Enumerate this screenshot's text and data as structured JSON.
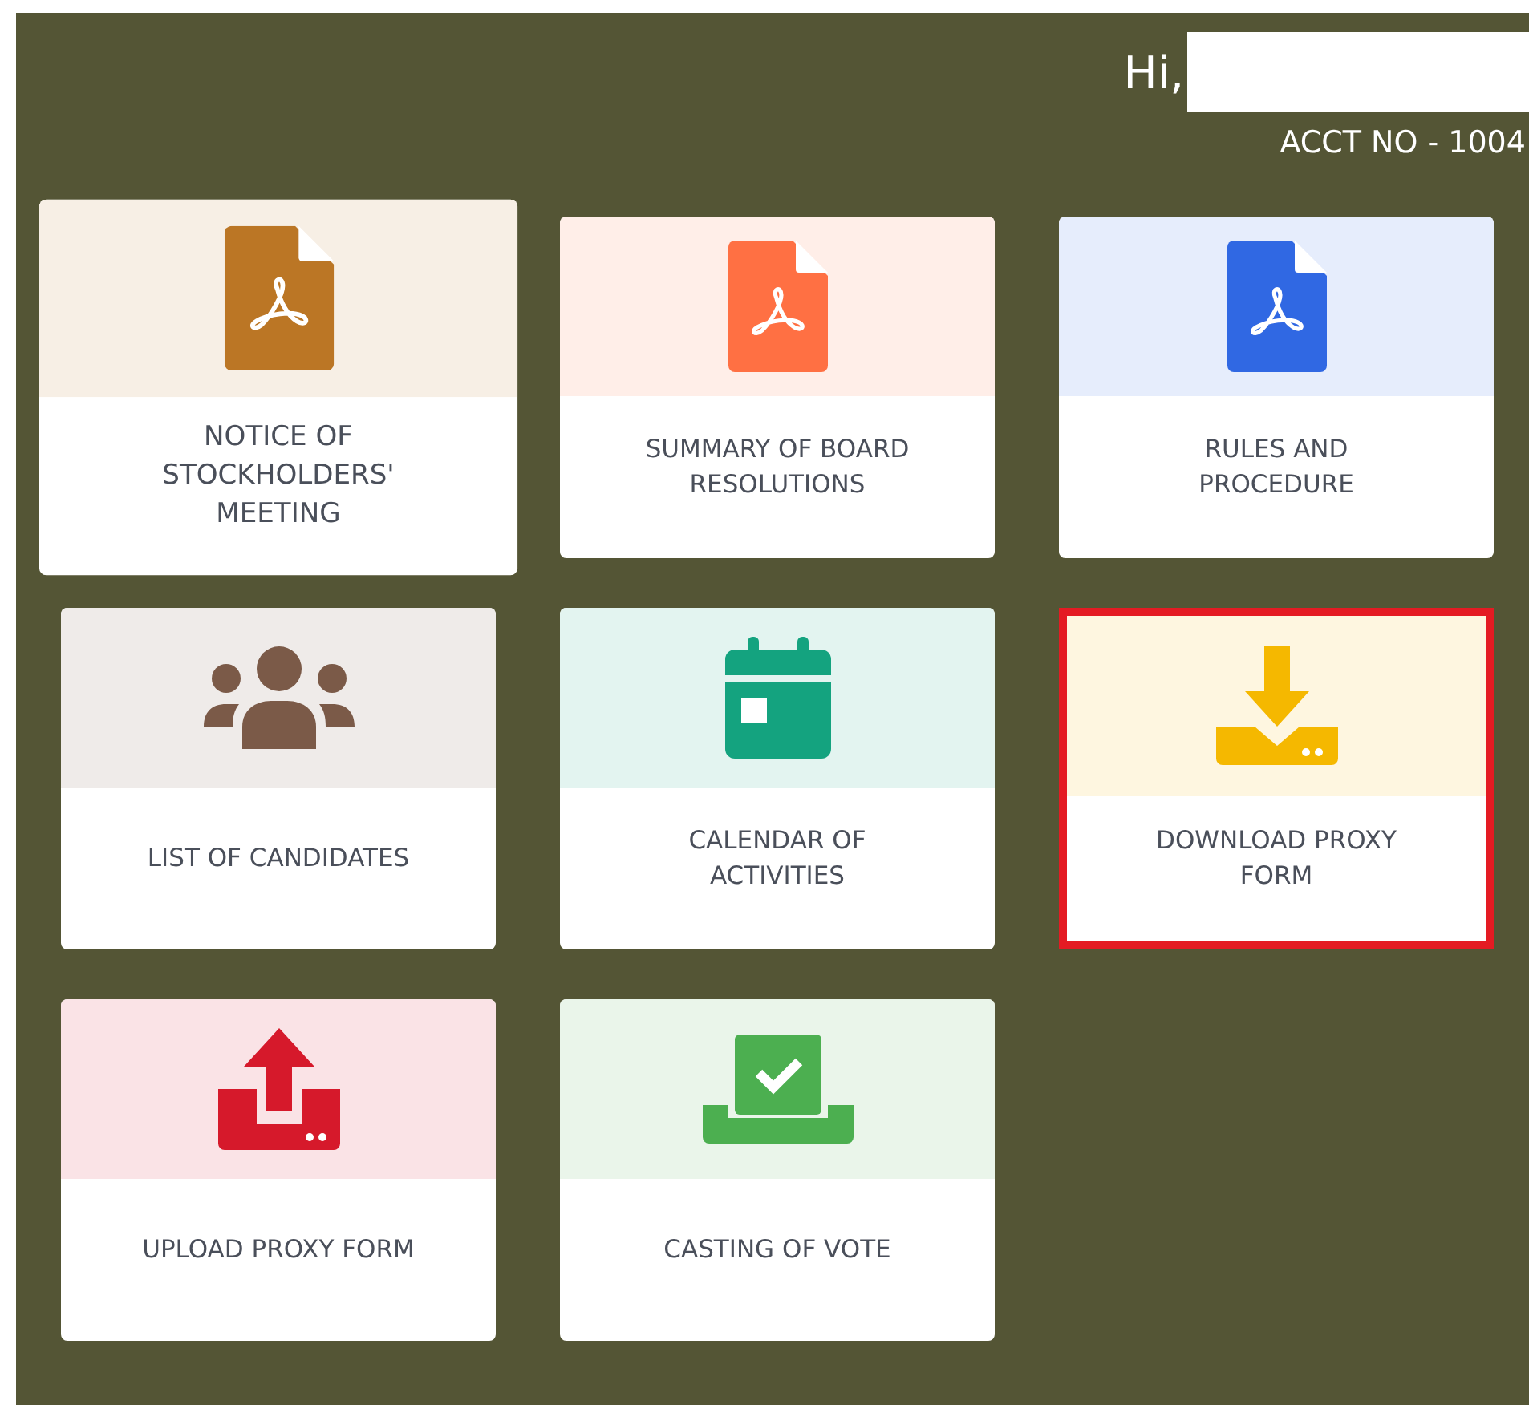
{
  "greeting": {
    "text": "Hi,",
    "name_redacted": true
  },
  "account": "ACCT NO - 1004",
  "cards": [
    {
      "lines": [
        "NOTICE OF",
        "STOCKHOLDERS'",
        "MEETING"
      ],
      "kind": "pdf",
      "color": "#bb7625",
      "raised": true,
      "selected": false
    },
    {
      "lines": [
        "SUMMARY OF BOARD",
        "RESOLUTIONS"
      ],
      "kind": "pdf",
      "color": "#ff7043",
      "raised": false,
      "selected": false
    },
    {
      "lines": [
        "RULES AND",
        "PROCEDURE"
      ],
      "kind": "pdf",
      "color": "#3068e3",
      "raised": false,
      "selected": false
    },
    {
      "lines": [
        "LIST OF CANDIDATES"
      ],
      "kind": "users",
      "color": "#7b5a48",
      "raised": false,
      "selected": false
    },
    {
      "lines": [
        "CALENDAR OF",
        "ACTIVITIES"
      ],
      "kind": "calendar",
      "color": "#14a37f",
      "raised": false,
      "selected": false
    },
    {
      "lines": [
        "DOWNLOAD PROXY",
        "FORM"
      ],
      "kind": "download",
      "color": "#f5b800",
      "raised": false,
      "selected": true
    },
    {
      "lines": [
        "UPLOAD PROXY FORM"
      ],
      "kind": "upload",
      "color": "#d6192b",
      "raised": false,
      "selected": false
    },
    {
      "lines": [
        "CASTING OF VOTE"
      ],
      "kind": "vote",
      "color": "#4caf50",
      "raised": false,
      "selected": false
    }
  ]
}
